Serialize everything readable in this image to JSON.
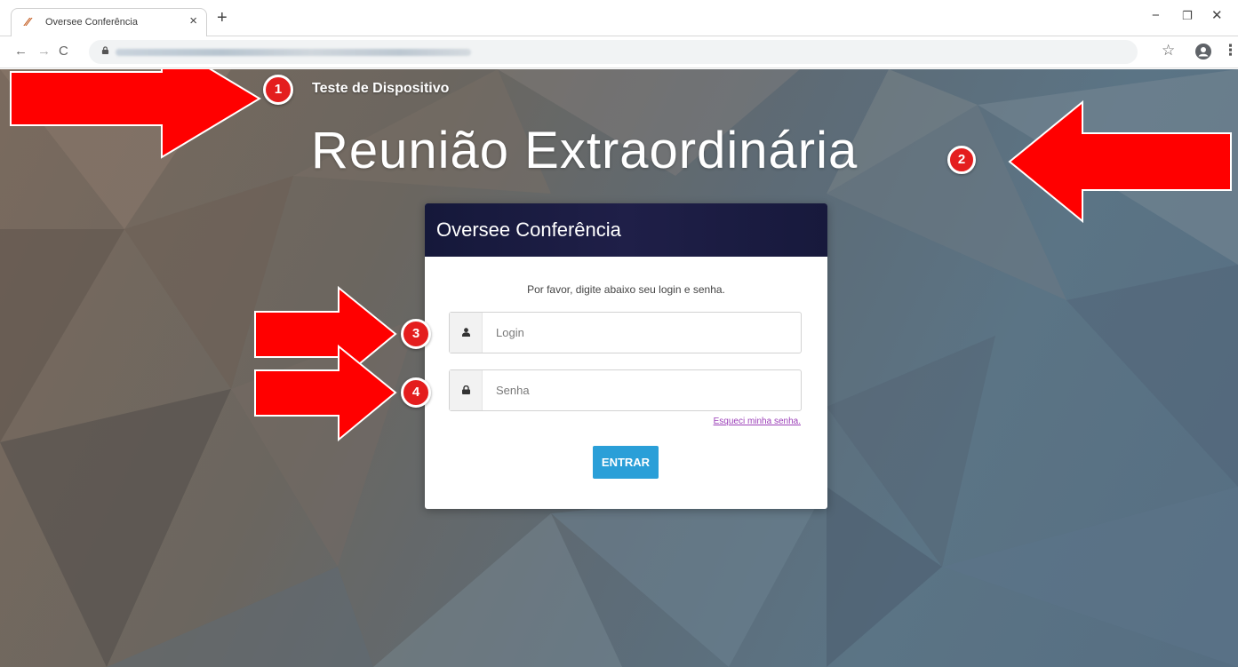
{
  "browser": {
    "tab_title": "Oversee Conferência",
    "tab_favicon": "oversee-logo-icon",
    "close_tab": "×",
    "new_tab": "+",
    "window_minimize": "−",
    "window_maximize": "❐",
    "window_close": "✕",
    "nav_back": "←",
    "nav_forward": "→",
    "nav_reload": "C",
    "bookmark_star": "☆",
    "menu": "⋮"
  },
  "page": {
    "header_title": "Teste de Dispositivo",
    "main_title": "Reunião Extraordinária",
    "card": {
      "title": "Oversee Conferência",
      "instructions": "Por favor, digite abaixo seu login e senha.",
      "login_placeholder": "Login",
      "password_placeholder": "Senha",
      "forgot_link": "Esqueci minha senha.",
      "submit_label": "ENTRAR"
    }
  },
  "annotations": {
    "badges": [
      "1",
      "2",
      "3",
      "4"
    ],
    "arrow_color": "#ff0000"
  },
  "colors": {
    "card_header": "#1b1c42",
    "button": "#2a9fd8",
    "link": "#9b3fb8",
    "badge": "#e41e1e"
  }
}
